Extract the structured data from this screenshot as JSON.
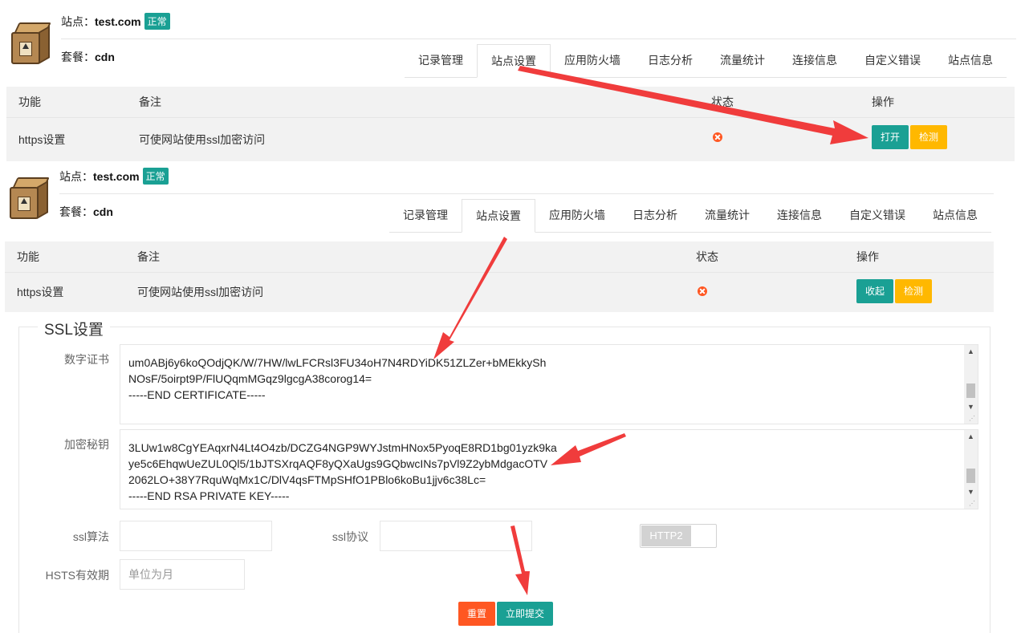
{
  "colors": {
    "accent": "#1aa094",
    "warning": "#ffb800",
    "danger": "#ff5722",
    "arrow": "#f03c3c"
  },
  "panels": [
    {
      "site_label": "站点：",
      "site_name": "test.com",
      "status_badge": "正常",
      "plan_label": "套餐：",
      "plan_name": "cdn",
      "tabs": [
        "记录管理",
        "站点设置",
        "应用防火墙",
        "日志分析",
        "流量统计",
        "连接信息",
        "自定义错误",
        "站点信息"
      ],
      "active_tab": "站点设置",
      "table": {
        "headers": [
          "功能",
          "备注",
          "状态",
          "操作"
        ],
        "row": {
          "feature": "https设置",
          "note": "可使网站使用ssl加密访问",
          "status_icon": "close-circle-icon"
        }
      },
      "actions": {
        "primary": "打开",
        "secondary": "检测"
      }
    },
    {
      "site_label": "站点：",
      "site_name": "test.com",
      "status_badge": "正常",
      "plan_label": "套餐：",
      "plan_name": "cdn",
      "tabs": [
        "记录管理",
        "站点设置",
        "应用防火墙",
        "日志分析",
        "流量统计",
        "连接信息",
        "自定义错误",
        "站点信息"
      ],
      "active_tab": "站点设置",
      "table": {
        "headers": [
          "功能",
          "备注",
          "状态",
          "操作"
        ],
        "row": {
          "feature": "https设置",
          "note": "可使网站使用ssl加密访问",
          "status_icon": "close-circle-icon"
        }
      },
      "actions": {
        "primary": "收起",
        "secondary": "检测"
      }
    }
  ],
  "ssl": {
    "legend": "SSL设置",
    "cert_label": "数字证书",
    "cert_lines": [
      "um0ABj6y6koQOdjQK/W/7HW/lwLFCRsl3FU34oH7N4RDYiDK51ZLZer+bMEkkySh",
      "NOsF/5oirpt9P/FlUQqmMGqz9lgcgA38corog14=",
      "-----END CERTIFICATE-----"
    ],
    "key_label": "加密秘钥",
    "key_lines": [
      "3LUw1w8CgYEAqxrN4Lt4O4zb/DCZG4NGP9WYJstmHNox5PyoqE8RD1bg01yzk9ka",
      "ye5c6EhqwUeZUL0Ql5/1bJTSXrqAQF8yQXaUgs9GQbwcINs7pVl9Z2ybMdgacOTV",
      "2062LO+38Y7RquWqMx1C/DlV4qsFTMpSHfO1PBlo6koBu1jjv6c38Lc=",
      "-----END RSA PRIVATE KEY-----"
    ],
    "algo_label": "ssl算法",
    "algo_value": "",
    "protocol_label": "ssl协议",
    "protocol_value": "",
    "http2_label": "HTTP2",
    "http2_on": false,
    "hsts_label": "HSTS有效期",
    "hsts_placeholder": "单位为月",
    "reset_label": "重置",
    "submit_label": "立即提交"
  }
}
